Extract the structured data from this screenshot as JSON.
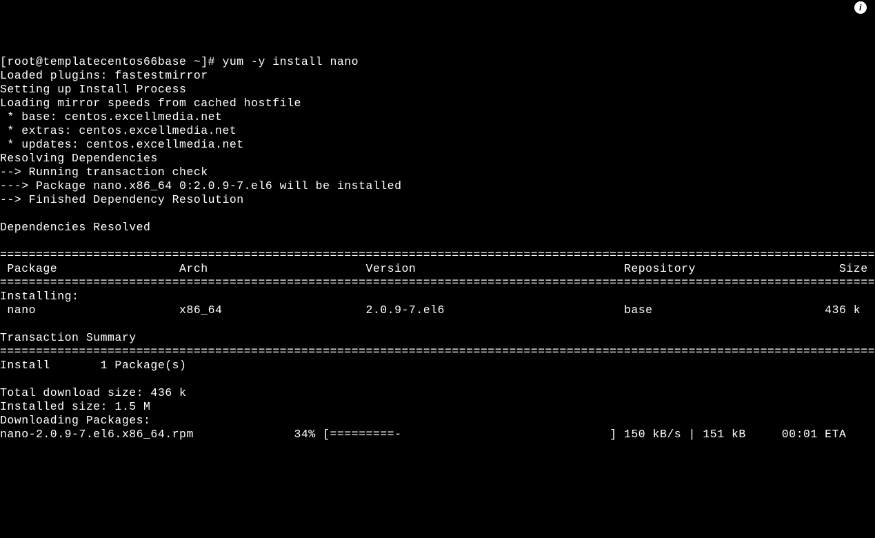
{
  "prompt": "[root@templatecentos66base ~]# ",
  "command": "yum -y install nano",
  "lines_top": [
    "Loaded plugins: fastestmirror",
    "Setting up Install Process",
    "Loading mirror speeds from cached hostfile",
    " * base: centos.excellmedia.net",
    " * extras: centos.excellmedia.net",
    " * updates: centos.excellmedia.net",
    "Resolving Dependencies",
    "--> Running transaction check",
    "---> Package nano.x86_64 0:2.0.9-7.el6 will be installed",
    "--> Finished Dependency Resolution",
    "",
    "Dependencies Resolved",
    ""
  ],
  "double_rule": "=====================================================================================================================================================",
  "table_header": " Package                 Arch                      Version                             Repository                    Size",
  "installing_label": "Installing:",
  "table_row": " nano                    x86_64                    2.0.9-7.el6                         base                        436 k",
  "transaction_summary_label": "Transaction Summary",
  "install_line": "Install       1 Package(s)",
  "blank": "",
  "total_download": "Total download size: 436 k",
  "installed_size": "Installed size: 1.5 M",
  "downloading_label": "Downloading Packages:",
  "progress_line": "nano-2.0.9-7.el6.x86_64.rpm              34% [=========-                             ] 150 kB/s | 151 kB     00:01 ETA",
  "info_icon_label": "i"
}
